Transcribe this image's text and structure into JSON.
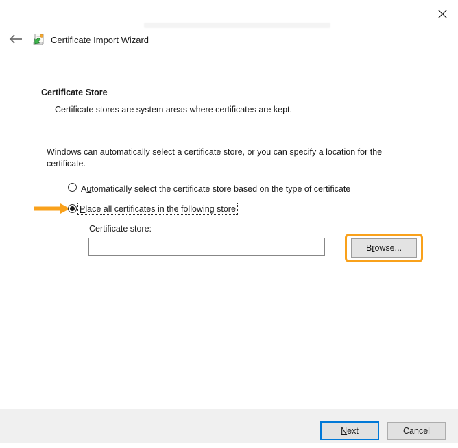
{
  "window": {
    "title": "Certificate Import Wizard"
  },
  "page": {
    "heading": "Certificate Store",
    "subheading": "Certificate stores are system areas where certificates are kept.",
    "intro": "Windows can automatically select a certificate store, or you can specify a location for the certificate."
  },
  "radio_group": {
    "auto": {
      "pre": "A",
      "mnemonic": "u",
      "post": "tomatically select the certificate store based on the type of certificate",
      "selected": false
    },
    "place": {
      "pre": "",
      "mnemonic": "P",
      "post": "lace all certificates in the following store",
      "selected": true
    }
  },
  "store_field": {
    "label": "Certificate store:",
    "value": "",
    "browse_button": {
      "pre": "B",
      "mnemonic": "r",
      "post": "owse..."
    }
  },
  "footer": {
    "next_button": {
      "pre": "",
      "mnemonic": "N",
      "post": "ext"
    },
    "cancel_button": "Cancel"
  },
  "annotations": {
    "arrow_color": "#F9A11B",
    "highlight_color": "#F9A11B",
    "default_button_border": "#0078D7"
  }
}
